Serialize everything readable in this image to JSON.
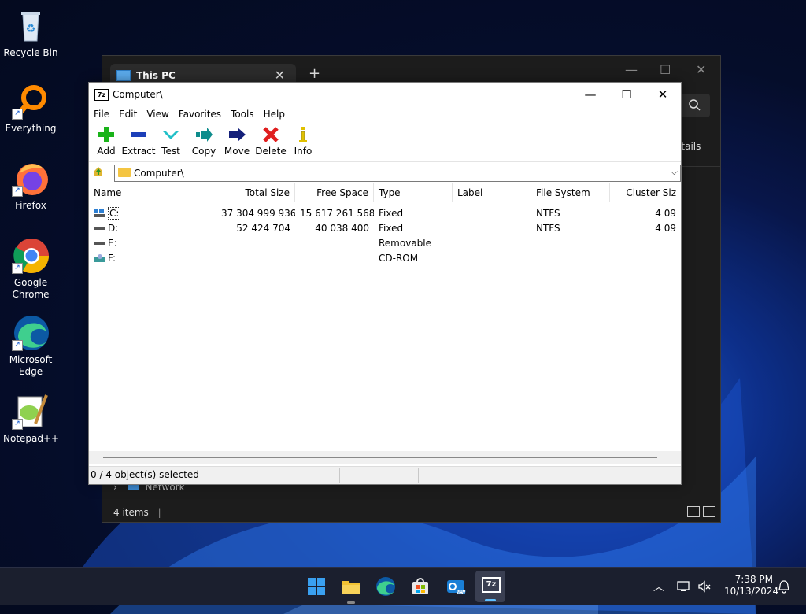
{
  "desktop": {
    "icons": [
      {
        "label": "Recycle Bin"
      },
      {
        "label": "Everything"
      },
      {
        "label": "Firefox"
      },
      {
        "label": "Google Chrome"
      },
      {
        "label": "Microsoft Edge"
      },
      {
        "label": "Notepad++"
      }
    ]
  },
  "explorer": {
    "tab_title": "This PC",
    "close": "✕",
    "new_tab": "+",
    "details_label": "etails",
    "nav_network": "Network",
    "item_count": "4 items"
  },
  "zip": {
    "title": "Computer\\",
    "logo": "7z",
    "menu": [
      "File",
      "Edit",
      "View",
      "Favorites",
      "Tools",
      "Help"
    ],
    "toolbar": [
      "Add",
      "Extract",
      "Test",
      "Copy",
      "Move",
      "Delete",
      "Info"
    ],
    "address": "Computer\\",
    "columns": [
      "Name",
      "Total Size",
      "Free Space",
      "Type",
      "Label",
      "File System",
      "Cluster Siz"
    ],
    "rows": [
      {
        "name": "C:",
        "total": "37 304 999 936",
        "free": "15 617 261 568",
        "type": "Fixed",
        "label": "",
        "fs": "NTFS",
        "cluster": "4 09"
      },
      {
        "name": "D:",
        "total": "52 424 704",
        "free": "40 038 400",
        "type": "Fixed",
        "label": "",
        "fs": "NTFS",
        "cluster": "4 09"
      },
      {
        "name": "E:",
        "total": "",
        "free": "",
        "type": "Removable",
        "label": "",
        "fs": "",
        "cluster": ""
      },
      {
        "name": "F:",
        "total": "",
        "free": "",
        "type": "CD-ROM",
        "label": "",
        "fs": "",
        "cluster": ""
      }
    ],
    "status": "0 / 4 object(s) selected"
  },
  "taskbar": {
    "time": "7:38 PM",
    "date": "10/13/2024",
    "sevenzip_label": "7z"
  },
  "colors": {
    "accent": "#0078d4",
    "add_green": "#19b319",
    "delete_red": "#e01e1e"
  }
}
